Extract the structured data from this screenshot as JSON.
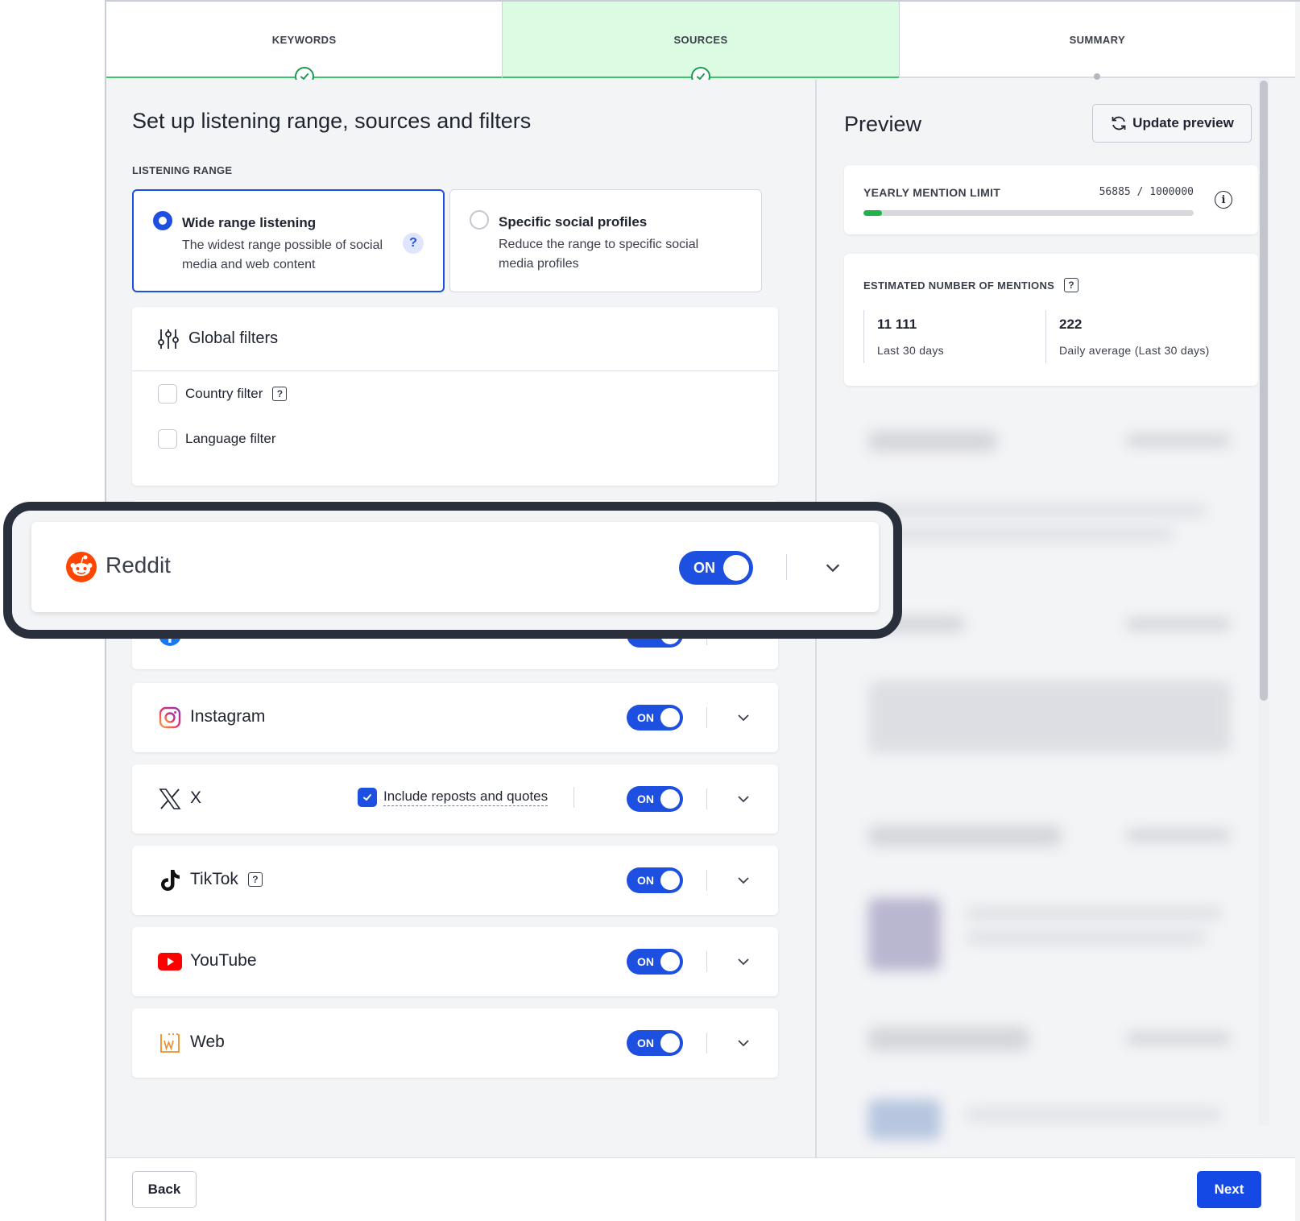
{
  "stepper": {
    "steps": [
      {
        "label": "KEYWORDS",
        "state": "done"
      },
      {
        "label": "SOURCES",
        "state": "active"
      },
      {
        "label": "SUMMARY",
        "state": "pending"
      }
    ]
  },
  "main": {
    "title": "Set up listening range, sources and filters",
    "listening_range_label": "LISTENING RANGE",
    "range_options": [
      {
        "title": "Wide range listening",
        "description": "The widest range possible of social media and web content",
        "selected": true
      },
      {
        "title": "Specific social profiles",
        "description": "Reduce the range to specific social media profiles",
        "selected": false
      }
    ],
    "global_filters": {
      "title": "Global filters",
      "filters": [
        {
          "label": "Country filter",
          "checked": false
        },
        {
          "label": "Language filter",
          "checked": false
        }
      ]
    },
    "sources": [
      {
        "name": "Reddit",
        "toggle": "ON"
      },
      {
        "name": "Facebook",
        "toggle": "ON"
      },
      {
        "name": "Instagram",
        "toggle": "ON"
      },
      {
        "name": "X",
        "toggle": "ON",
        "extra_option": "Include reposts and quotes"
      },
      {
        "name": "TikTok",
        "toggle": "ON"
      },
      {
        "name": "YouTube",
        "toggle": "ON"
      },
      {
        "name": "Web",
        "toggle": "ON"
      }
    ]
  },
  "preview": {
    "title": "Preview",
    "update_button": "Update preview",
    "mention_limit": {
      "label": "YEARLY MENTION LIMIT",
      "value_text": "56885 / 1000000",
      "used": 56885,
      "limit": 1000000
    },
    "estimated": {
      "label": "ESTIMATED NUMBER OF MENTIONS",
      "stats": [
        {
          "value": "11 111",
          "caption": "Last 30 days"
        },
        {
          "value": "222",
          "caption": "Daily average (Last 30 days)"
        }
      ]
    }
  },
  "footer": {
    "back": "Back",
    "next": "Next"
  },
  "icons": {
    "help": "?",
    "info": "i"
  },
  "colors": {
    "accent": "#1d4fe0",
    "success": "#22b24c",
    "active_step_bg": "#dcfbe3",
    "reddit": "#ff4500",
    "youtube": "#ff0000",
    "facebook": "#1877f2"
  }
}
